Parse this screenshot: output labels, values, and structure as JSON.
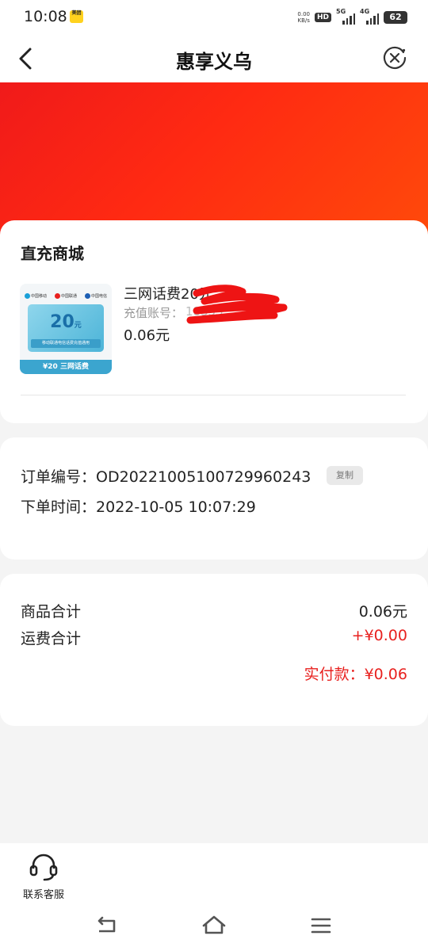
{
  "status_bar": {
    "time": "10:08",
    "app_icon_text": "美团",
    "net_speed_value": "0.00",
    "net_speed_unit": "KB/s",
    "hd_label": "HD",
    "network_1": "5G",
    "network_2": "4G",
    "battery": "62"
  },
  "nav": {
    "title": "惠享义乌"
  },
  "shop": {
    "title": "直充商城",
    "product_name": "三网话费20元",
    "recharge_label": "充值账号：",
    "recharge_account": "18355",
    "price": "0.06元",
    "thumbnail": {
      "logo_1": "中国移动",
      "logo_2": "中国联通",
      "logo_3": "中国电信",
      "amount": "20",
      "amount_unit": "元",
      "note": "移动联通电信话费充值通用",
      "footer": "¥20 三网话费"
    }
  },
  "order": {
    "number_label": "订单编号：",
    "number_value": "OD20221005100729960243",
    "copy_label": "复制",
    "time_label": "下单时间：",
    "time_value": "2022-10-05 10:07:29"
  },
  "totals": {
    "goods_label": "商品合计",
    "goods_value": "0.06元",
    "shipping_label": "运费合计",
    "shipping_value": "+¥0.00",
    "paid_label": "实付款：",
    "paid_value": "¥0.06"
  },
  "bottom": {
    "service_label": "联系客服"
  },
  "colors": {
    "accent_red": "#e8211f",
    "banner_start": "#f01a1a",
    "banner_end": "#ff4a0a"
  }
}
